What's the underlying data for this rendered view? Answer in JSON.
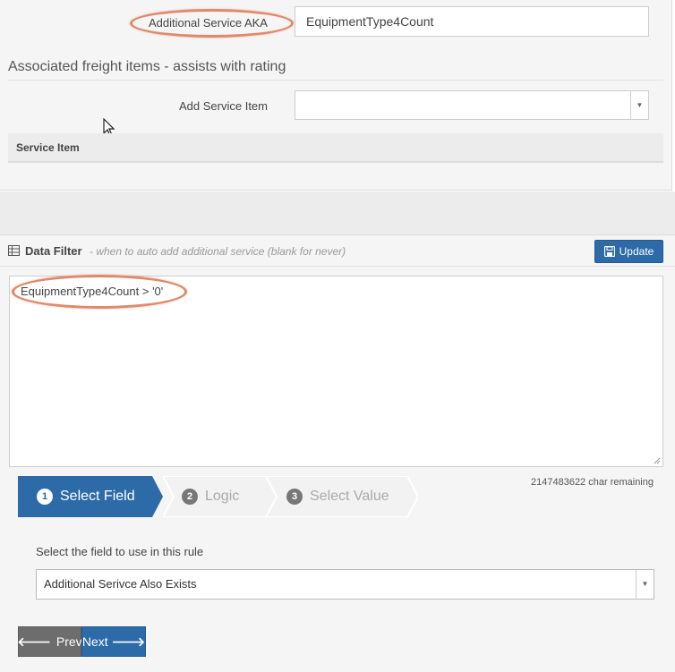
{
  "service": {
    "aka_label": "Additional Service AKA",
    "aka_value": "EquipmentType4Count"
  },
  "freight": {
    "section_title": "Associated freight items - assists with rating",
    "add_label": "Add Service Item",
    "add_value": "",
    "table_header": "Service Item"
  },
  "data_filter": {
    "title": "Data Filter",
    "subtitle": "- when to auto add additional service (blank for never)",
    "update_label": "Update",
    "expression": "EquipmentType4Count > '0'",
    "char_remaining": "2147483622 char remaining"
  },
  "wizard": {
    "steps": [
      {
        "number": "1",
        "label": "Select Field",
        "state": "active"
      },
      {
        "number": "2",
        "label": "Logic",
        "state": "inactive"
      },
      {
        "number": "3",
        "label": "Select Value",
        "state": "inactive"
      }
    ],
    "field_prompt": "Select the field to use in this rule",
    "field_selected": "Additional Serivce Also Exists",
    "prev_label": "Prev",
    "next_label": "Next"
  },
  "colors": {
    "primary": "#2c6aa8",
    "prev_button": "#6d6d6d",
    "highlight_oval": "#e08a6a",
    "inactive_step": "#f0f0f0"
  },
  "icons": [
    "table-grid-icon",
    "save-disk-icon",
    "arrow-left-icon",
    "arrow-right-icon",
    "dropdown-caret-icon",
    "mouse-cursor-icon",
    "resize-grip-icon"
  ]
}
